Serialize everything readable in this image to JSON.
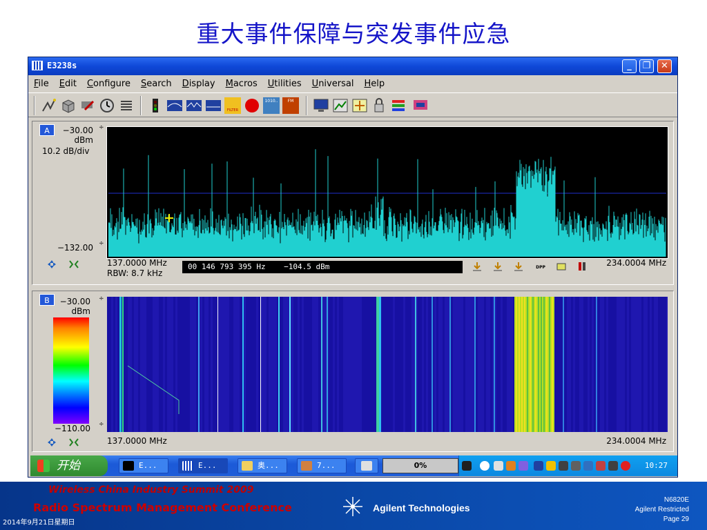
{
  "slide": {
    "title": "重大事件保障与突发事件应急"
  },
  "window": {
    "title": "E3238s",
    "controls": {
      "minimize": "_",
      "restore": "❐",
      "close": "✕"
    },
    "menu": [
      "File",
      "Edit",
      "Configure",
      "Search",
      "Display",
      "Macros",
      "Utilities",
      "Universal",
      "Help"
    ],
    "toolbar_icons": [
      "signal-icon",
      "cube-icon",
      "tools-icon",
      "clock-icon",
      "list-icon",
      "traffic-light-icon",
      "spectrum-f1-icon",
      "spectrum-f2-icon",
      "spectrum-flat-icon",
      "filter-icon",
      "record-icon",
      "data-icon",
      "fm-icon",
      "monitor-icon",
      "chart-icon",
      "arrows-icon",
      "lock-icon",
      "stack-icon",
      "network-icon"
    ],
    "toolbar_labels": {
      "filter": "FILTER",
      "data": "1010..",
      "fm": "FM"
    }
  },
  "panel_a": {
    "label": "A",
    "ref_level": "−30.00",
    "ref_unit": "dBm",
    "scale": "10.2 dB/div",
    "bottom_level": "−132.00",
    "start_freq": "137.0000 MHz",
    "stop_freq": "234.0004 MHz",
    "rbw": "RBW: 8.7 kHz",
    "readout_freq": "00 146 793 395 Hz",
    "readout_power": "−104.5 dBm",
    "marker_icons": [
      "marker-1-icon",
      "marker-2-icon",
      "marker-3-icon",
      "marker-dpp-icon",
      "marker-peak-icon",
      "marker-bars-icon"
    ],
    "marker_labels": {
      "dpp": "DPP"
    }
  },
  "panel_b": {
    "label": "B",
    "ref_level": "−30.00",
    "ref_unit": "dBm",
    "bottom_level": "−110.00",
    "start_freq": "137.0000 MHz",
    "stop_freq": "234.0004 MHz"
  },
  "taskbar": {
    "start": "开始",
    "tasks": [
      {
        "label": "E...",
        "icon": "cmd-icon"
      },
      {
        "label": "E...",
        "icon": "e3238-icon"
      },
      {
        "label": "奥...",
        "icon": "folder-icon"
      },
      {
        "label": "7...",
        "icon": "app-icon"
      }
    ],
    "progress": "0%",
    "clock": "10:27"
  },
  "footer": {
    "line1": "Wireless China Industry Summit 2009",
    "line2": "Radio Spectrum Management Conference",
    "date": "2014年9月21日星期日",
    "company": "Agilent Technologies",
    "model": "N6820E",
    "restriction": "Agilent Restricted",
    "page": "Page 29"
  },
  "colors": {
    "title": "#1515c8",
    "trace": "#20d0d0",
    "footer_red": "#c00000",
    "xp_blue": "#1e5cd8"
  }
}
